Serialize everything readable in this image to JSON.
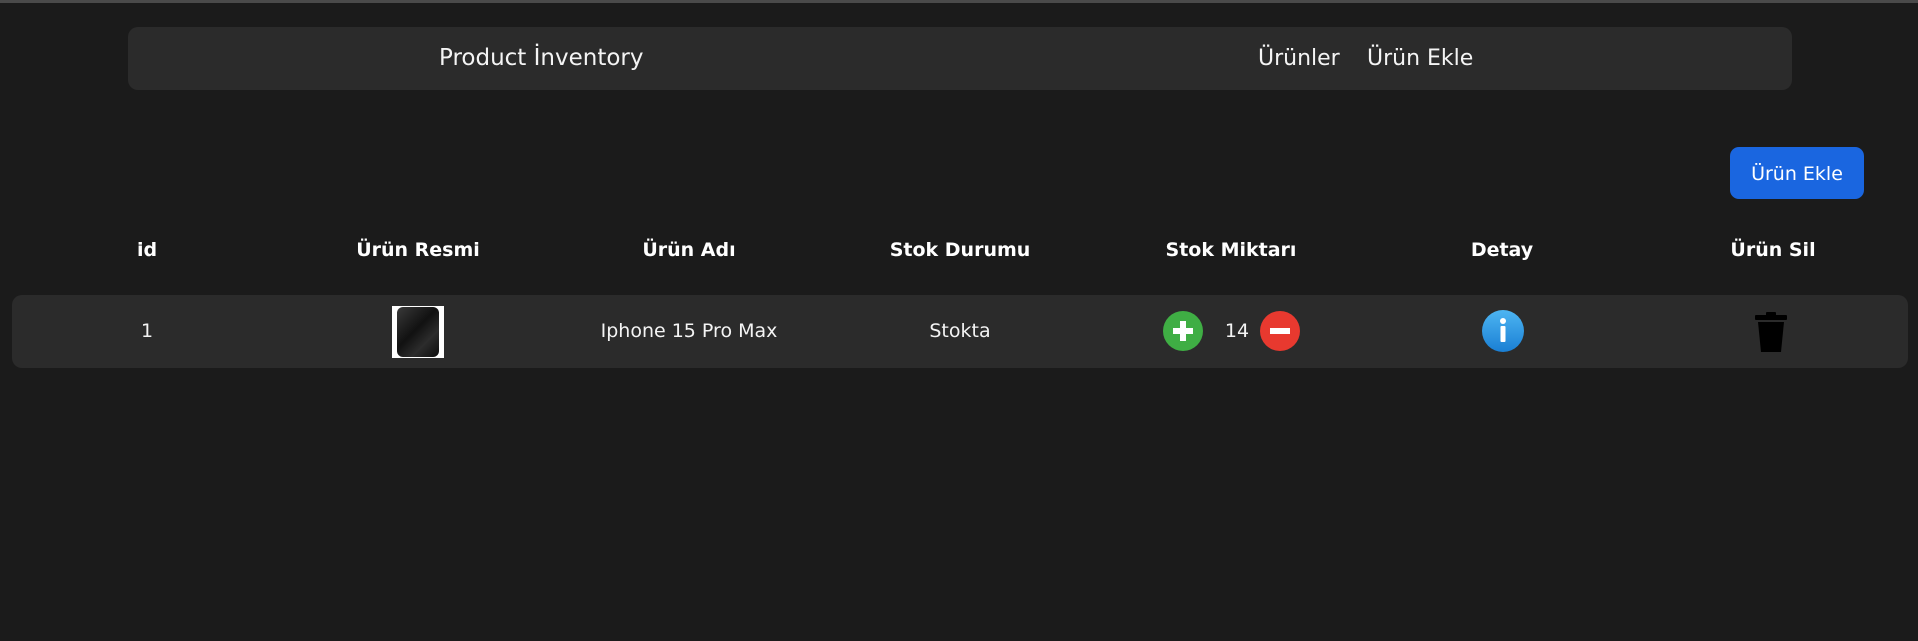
{
  "navbar": {
    "brand": "Product İnventory",
    "links": [
      "Ürünler",
      "Ürün Ekle"
    ]
  },
  "actions": {
    "add_button_label": "Ürün Ekle"
  },
  "table": {
    "headers": [
      "id",
      "Ürün Resmi",
      "Ürün Adı",
      "Stok Durumu",
      "Stok Miktarı",
      "Detay",
      "Ürün Sil"
    ],
    "rows": [
      {
        "id": "1",
        "name": "Iphone 15 Pro Max",
        "status": "Stokta",
        "quantity": "14"
      }
    ]
  },
  "colors": {
    "background": "#1b1b1b",
    "panel": "#2b2b2b",
    "primary": "#1a66e0",
    "increase": "#3fae44",
    "decrease": "#e8392f",
    "info": "#2b95e0"
  },
  "icons": [
    "plus-icon",
    "minus-icon",
    "info-icon",
    "trash-icon",
    "product-thumbnail"
  ]
}
